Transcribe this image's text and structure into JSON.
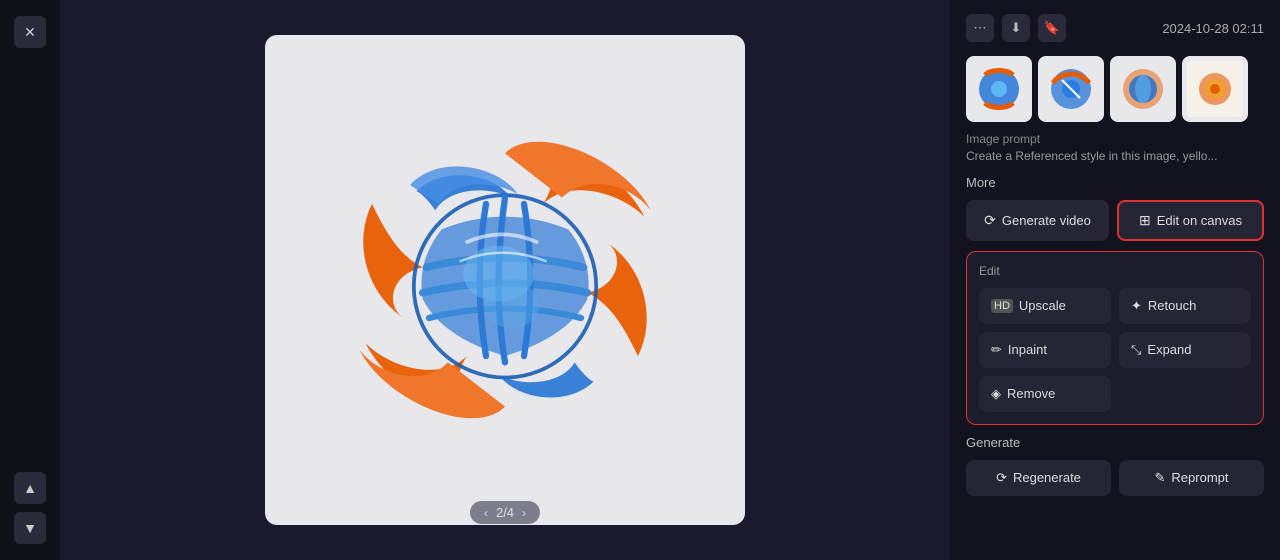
{
  "app": {
    "timestamp": "2024-10-28 02:11",
    "pagination": {
      "current": 2,
      "total": 4,
      "label": "2/4"
    }
  },
  "header_actions": {
    "more_icon": "⋯",
    "download_icon": "⬇",
    "bookmark_icon": "🔖"
  },
  "image_prompt": {
    "label": "Image prompt",
    "text": "Create a Referenced style in this image, yello..."
  },
  "more_section": {
    "label": "More",
    "generate_video_label": "Generate video",
    "edit_on_canvas_label": "Edit on canvas"
  },
  "edit_section": {
    "label": "Edit",
    "upscale_label": "Upscale",
    "retouch_label": "Retouch",
    "inpaint_label": "Inpaint",
    "expand_label": "Expand",
    "remove_label": "Remove"
  },
  "generate_section": {
    "label": "Generate",
    "regenerate_label": "Regenerate",
    "reprompt_label": "Reprompt"
  },
  "nav": {
    "up_label": "▲",
    "down_label": "▼",
    "close_label": "✕",
    "prev_label": "‹",
    "next_label": "›"
  }
}
